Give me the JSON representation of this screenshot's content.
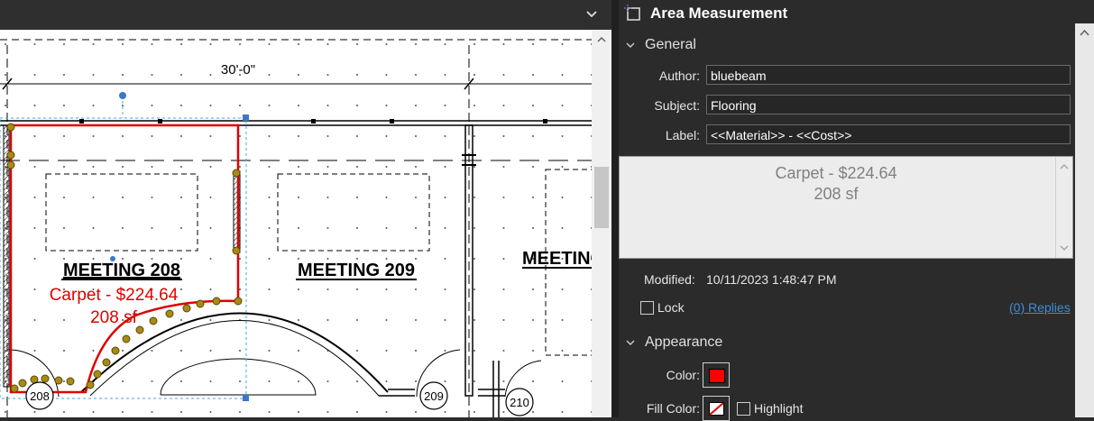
{
  "panel": {
    "title": "Area Measurement",
    "general": {
      "heading": "General",
      "author_label": "Author:",
      "author_value": "bluebeam",
      "subject_label": "Subject:",
      "subject_value": "Flooring",
      "label_label": "Label:",
      "label_value": "<<Material>> - <<Cost>>"
    },
    "preview": {
      "line1": "Carpet - $224.64",
      "line2": "208 sf"
    },
    "modified_label": "Modified:",
    "modified_value": "10/11/2023 1:48:47 PM",
    "lock_label": "Lock",
    "replies_link": "(0) Replies",
    "appearance": {
      "heading": "Appearance",
      "color_label": "Color:",
      "color_value": "#ff0000",
      "fill_color_label": "Fill Color:",
      "highlight_label": "Highlight"
    }
  },
  "drawing": {
    "dimension": "30'-0\"",
    "room_208": "MEETING   208",
    "room_209": "MEETING   209",
    "room_210": "MEETING",
    "markup_line1": "Carpet - $224.64",
    "markup_line2": "208 sf",
    "tag_208": "208",
    "tag_209": "209",
    "tag_210": "210"
  },
  "icons": [
    "chevron-down-icon",
    "area-measurement-icon",
    "chevron-up-icon"
  ]
}
